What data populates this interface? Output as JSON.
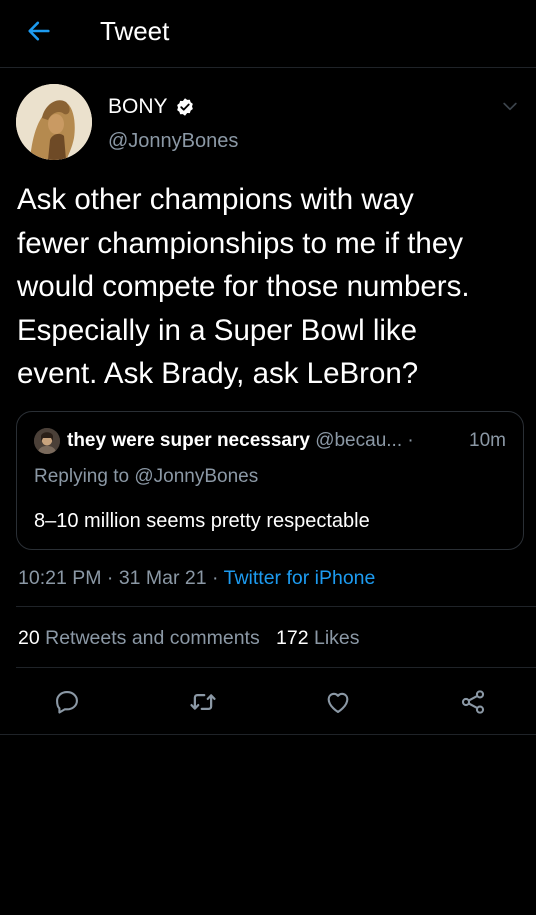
{
  "header": {
    "title": "Tweet"
  },
  "author": {
    "display_name": "BONY",
    "handle": "@JonnyBones",
    "verified": true
  },
  "tweet": {
    "text": "Ask other champions with way\nfewer championships to me if they\nwould compete for those numbers.\nEspecially in a Super Bowl like\nevent. Ask Brady, ask LeBron?"
  },
  "quote": {
    "display_name": "they were super necessary",
    "handle": "@becau...",
    "separator": "·",
    "time": "10m",
    "reply_prefix": "Replying to ",
    "reply_to": "@JonnyBones",
    "text": "8–10 million seems pretty respectable"
  },
  "meta": {
    "time": "10:21 PM",
    "sep1": "·",
    "date": "31 Mar 21",
    "sep2": "·",
    "source": "Twitter for iPhone"
  },
  "stats": {
    "retweets_count": "20",
    "retweets_label": "Retweets and comments",
    "likes_count": "172",
    "likes_label": "Likes"
  },
  "icons": {
    "back": "arrow-left-icon",
    "verified": "verified-badge-icon",
    "caret": "chevron-down-icon",
    "reply": "reply-icon",
    "retweet": "retweet-icon",
    "like": "heart-icon",
    "share": "share-icon"
  },
  "colors": {
    "background": "#000000",
    "accent": "#1d9bf0",
    "muted": "#8b98a5",
    "divider": "#1f2328"
  }
}
